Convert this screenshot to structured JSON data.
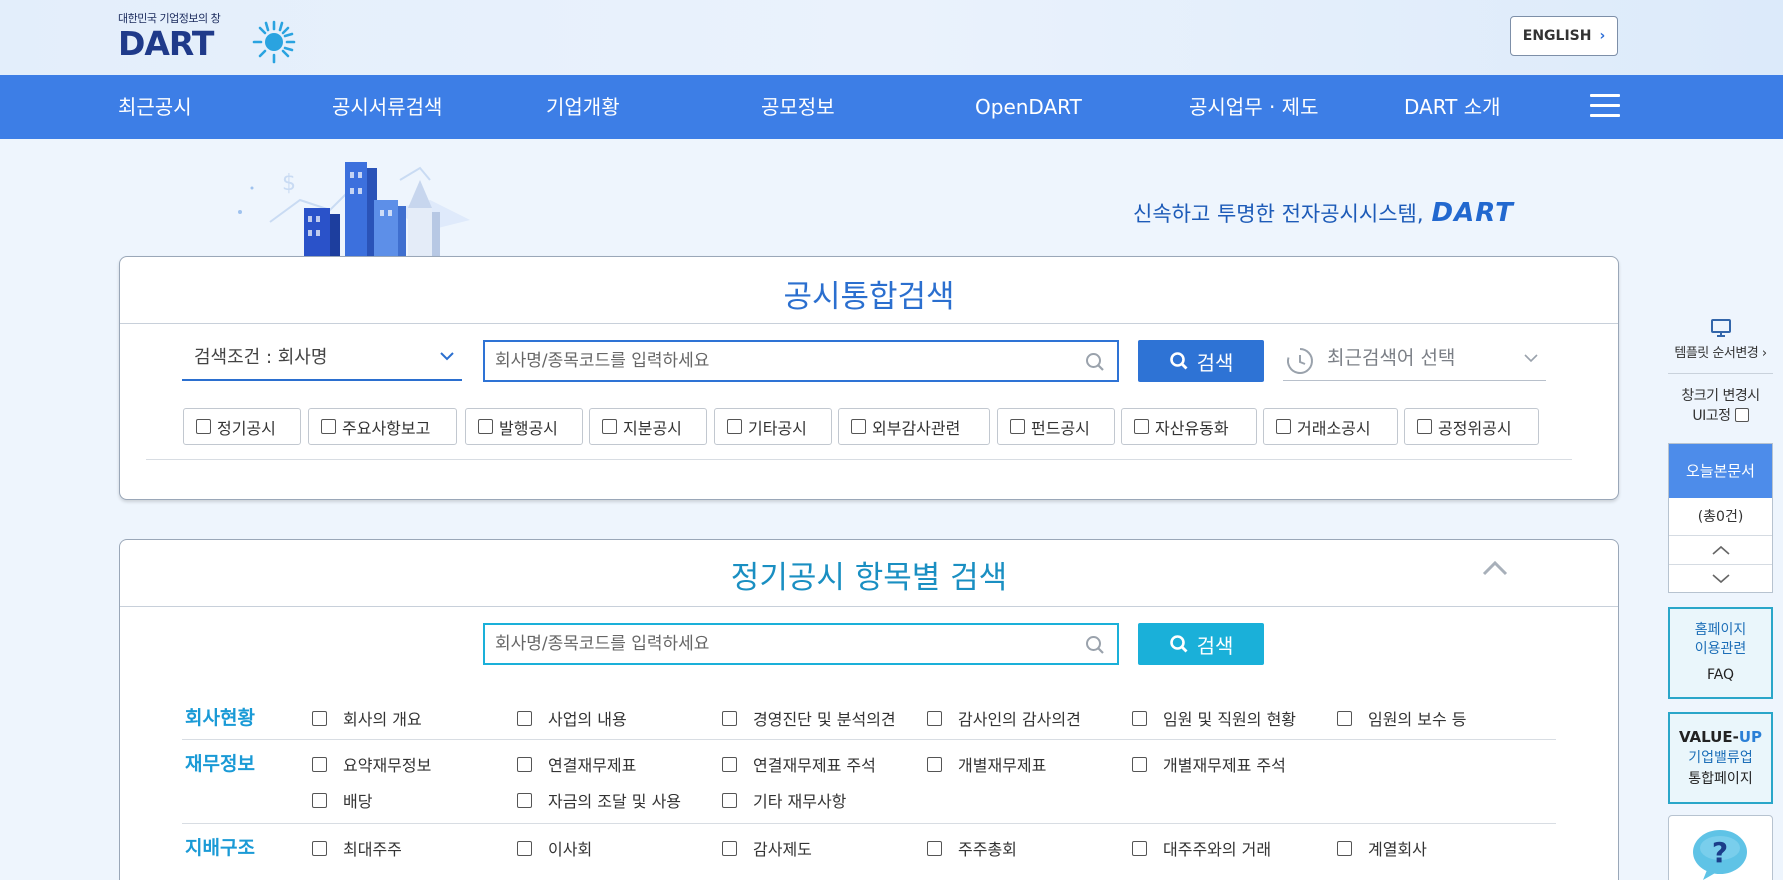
{
  "header": {
    "logo_tagline": "대한민국 기업정보의 창",
    "logo_word": "DART",
    "english_label": "ENGLISH"
  },
  "nav": {
    "items": [
      "최근공시",
      "공시서류검색",
      "기업개황",
      "공모정보",
      "OpenDART",
      "공시업무 · 제도",
      "DART 소개"
    ]
  },
  "hero": {
    "slogan": "신속하고 투명한 전자공시시스템,",
    "slogan_brand": "DART"
  },
  "integrated_search": {
    "title": "공시통합검색",
    "condition_label": "검색조건 : 회사명",
    "placeholder": "회사명/종목코드를 입력하세요",
    "search_label": "검색",
    "recent_label": "최근검색어 선택",
    "filters": [
      "정기공시",
      "주요사항보고",
      "발행공시",
      "지분공시",
      "기타공시",
      "외부감사관련",
      "펀드공시",
      "자산유동화",
      "거래소공시",
      "공정위공시"
    ]
  },
  "periodic_search": {
    "title": "정기공시 항목별 검색",
    "placeholder": "회사명/종목코드를 입력하세요",
    "search_label": "검색",
    "categories": [
      {
        "label": "회사현황",
        "items": [
          "회사의 개요",
          "사업의 내용",
          "경영진단 및 분석의견",
          "감사인의 감사의견",
          "임원 및 직원의 현황",
          "임원의 보수 등"
        ]
      },
      {
        "label": "재무정보",
        "items": [
          "요약재무정보",
          "연결재무제표",
          "연결재무제표 주석",
          "개별재무제표",
          "개별재무제표 주석",
          "배당",
          "자금의 조달 및 사용",
          "기타 재무사항"
        ]
      },
      {
        "label": "지배구조",
        "items": [
          "최대주주",
          "이사회",
          "감사제도",
          "주주총회",
          "대주주와의 거래",
          "계열회사"
        ]
      }
    ]
  },
  "quick_menu": {
    "template_label": "템플릿 순서변경",
    "resize_label_1": "창크기 변경시",
    "resize_label_2": "UI고정",
    "today_docs_label": "오늘본문서",
    "today_docs_count": "(총0건)",
    "homepage_label_1": "홈페이지",
    "homepage_label_2": "이용관련",
    "faq_label": "FAQ",
    "value_up_label": "VALUE-",
    "value_up_accent": "UP",
    "value_up_sub": "기업밸류업",
    "value_up_sub2": "통합페이지"
  },
  "colors": {
    "nav_bg": "#3d7ee6",
    "search_button": "#2e73d5",
    "periodic_button": "#1ab0d9",
    "category_label": "#1a9ad6"
  },
  "icons": [
    "sun-logo-icon",
    "chevron-right-icon",
    "hamburger-icon",
    "chevron-down-icon",
    "magnifier-icon",
    "clock-icon",
    "caret-up-icon",
    "monitor-icon",
    "arrow-up-icon",
    "arrow-down-icon",
    "help-icon"
  ]
}
